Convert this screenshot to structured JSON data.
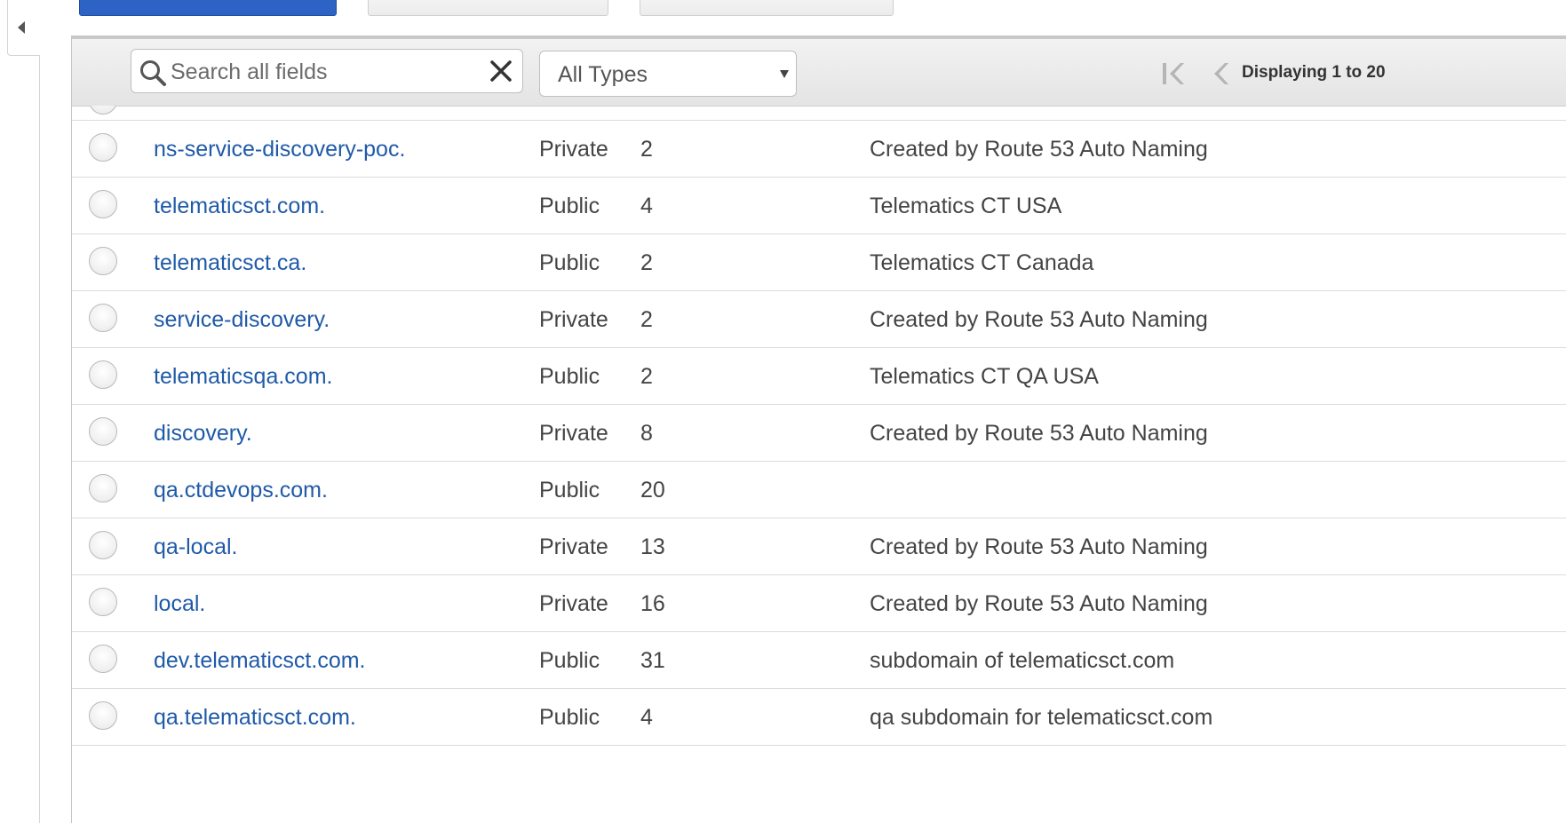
{
  "search": {
    "placeholder": "Search all fields"
  },
  "filter": {
    "selected": "All Types"
  },
  "pager": {
    "status": "Displaying 1 to 20"
  },
  "colors": {
    "link": "#1f5aa8",
    "primary_button": "#2c63c4"
  },
  "rows": [
    {
      "name": "ns-service-discovery-poc.",
      "type": "Private",
      "count": "2",
      "comment": "Created by Route 53 Auto Naming"
    },
    {
      "name": "telematicsct.com.",
      "type": "Public",
      "count": "4",
      "comment": "Telematics CT USA"
    },
    {
      "name": "telematicsct.ca.",
      "type": "Public",
      "count": "2",
      "comment": "Telematics CT Canada"
    },
    {
      "name": "service-discovery.",
      "type": "Private",
      "count": "2",
      "comment": "Created by Route 53 Auto Naming"
    },
    {
      "name": "telematicsqa.com.",
      "type": "Public",
      "count": "2",
      "comment": "Telematics CT QA USA"
    },
    {
      "name": "discovery.",
      "type": "Private",
      "count": "8",
      "comment": "Created by Route 53 Auto Naming"
    },
    {
      "name": "qa.ctdevops.com.",
      "type": "Public",
      "count": "20",
      "comment": ""
    },
    {
      "name": "qa-local.",
      "type": "Private",
      "count": "13",
      "comment": "Created by Route 53 Auto Naming"
    },
    {
      "name": "local.",
      "type": "Private",
      "count": "16",
      "comment": "Created by Route 53 Auto Naming"
    },
    {
      "name": "dev.telematicsct.com.",
      "type": "Public",
      "count": "31",
      "comment": "subdomain of telematicsct.com"
    },
    {
      "name": "qa.telematicsct.com.",
      "type": "Public",
      "count": "4",
      "comment": "qa subdomain for telematicsct.com"
    }
  ]
}
